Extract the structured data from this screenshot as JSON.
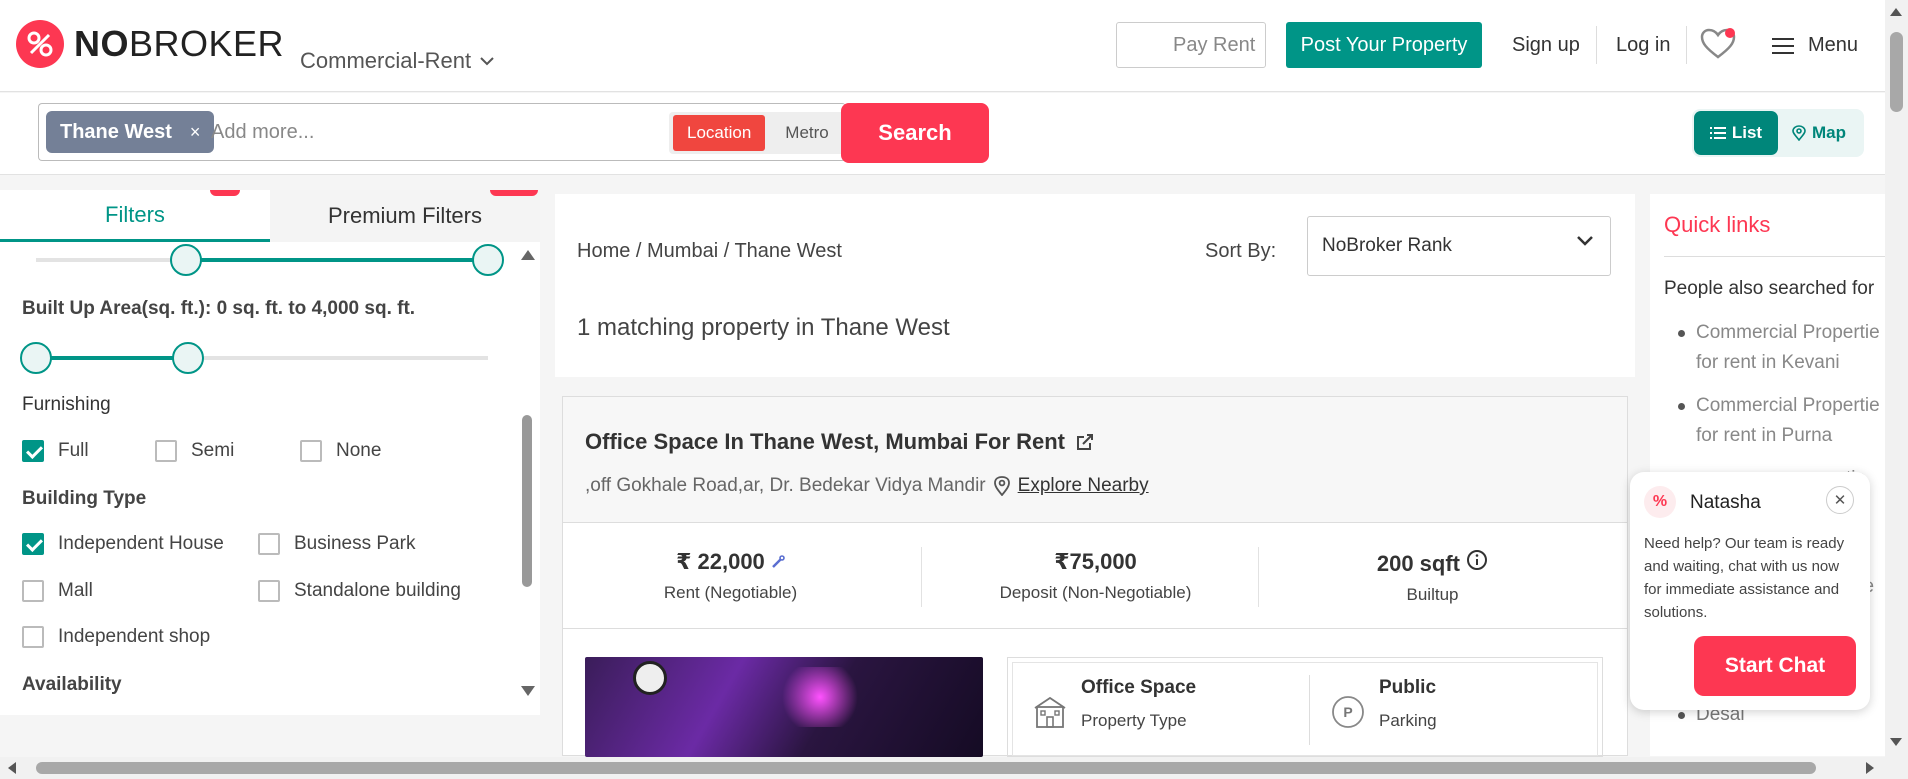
{
  "header": {
    "logo": {
      "bold": "NO",
      "light": "BROKER"
    },
    "category": "Commercial-Rent",
    "pay_rent": "Pay Rent",
    "post_property": "Post Your Property",
    "sign_up": "Sign up",
    "log_in": "Log in",
    "menu": "Menu"
  },
  "search": {
    "chip": "Thane West",
    "chip_close": "×",
    "placeholder": "Add more...",
    "location": "Location",
    "metro": "Metro",
    "button": "Search",
    "view_list": "List",
    "view_map": "Map"
  },
  "filters": {
    "tab_filters": "Filters",
    "tab_premium": "Premium Filters",
    "built_up_label": "Built Up Area(sq. ft.): 0 sq. ft. to 4,000 sq. ft.",
    "furnishing_label": "Furnishing",
    "furnishing": [
      {
        "label": "Full",
        "checked": true
      },
      {
        "label": "Semi",
        "checked": false
      },
      {
        "label": "None",
        "checked": false
      }
    ],
    "building_type_label": "Building Type",
    "building_types": [
      {
        "label": "Independent House",
        "checked": true
      },
      {
        "label": "Business Park",
        "checked": false
      },
      {
        "label": "Mall",
        "checked": false
      },
      {
        "label": "Standalone building",
        "checked": false
      },
      {
        "label": "Independent shop",
        "checked": false
      }
    ],
    "availability_label": "Availability"
  },
  "results": {
    "breadcrumb": "Home  / Mumbai / Thane West",
    "sort_label": "Sort By:",
    "sort_value": "NoBroker Rank",
    "count_text": "1 matching property in Thane West"
  },
  "property": {
    "title": "Office Space In Thane West, Mumbai For Rent",
    "address": ",off Gokhale Road,ar, Dr. Bedekar Vidya Mandir",
    "explore": "Explore Nearby",
    "rent_value": "₹ 22,000",
    "rent_sub": "Rent (Negotiable)",
    "deposit_value": "₹75,000",
    "deposit_sub": "Deposit (Non-Negotiable)",
    "area_value": "200 sqft",
    "area_sub": "Builtup",
    "type_title": "Office Space",
    "type_sub": "Property Type",
    "parking_title": "Public",
    "parking_sub": "Parking"
  },
  "quick_links": {
    "title": "Quick links",
    "people_also": "People also searched for",
    "items": [
      "Commercial Propertie",
      "for rent in Kevani",
      "Commercial Propertie",
      "for rent in Purna"
    ],
    "partial": [
      {
        "text": "tie"
      },
      {
        "text": "tie"
      },
      {
        "text": "ke"
      },
      {
        "text": "Desai"
      }
    ]
  },
  "chat": {
    "name": "Natasha",
    "message": "Need help? Our team is ready and waiting, chat with us now for immediate assistance and solutions.",
    "button": "Start Chat"
  },
  "colors": {
    "brand_red": "#fd3752",
    "teal": "#009587"
  }
}
